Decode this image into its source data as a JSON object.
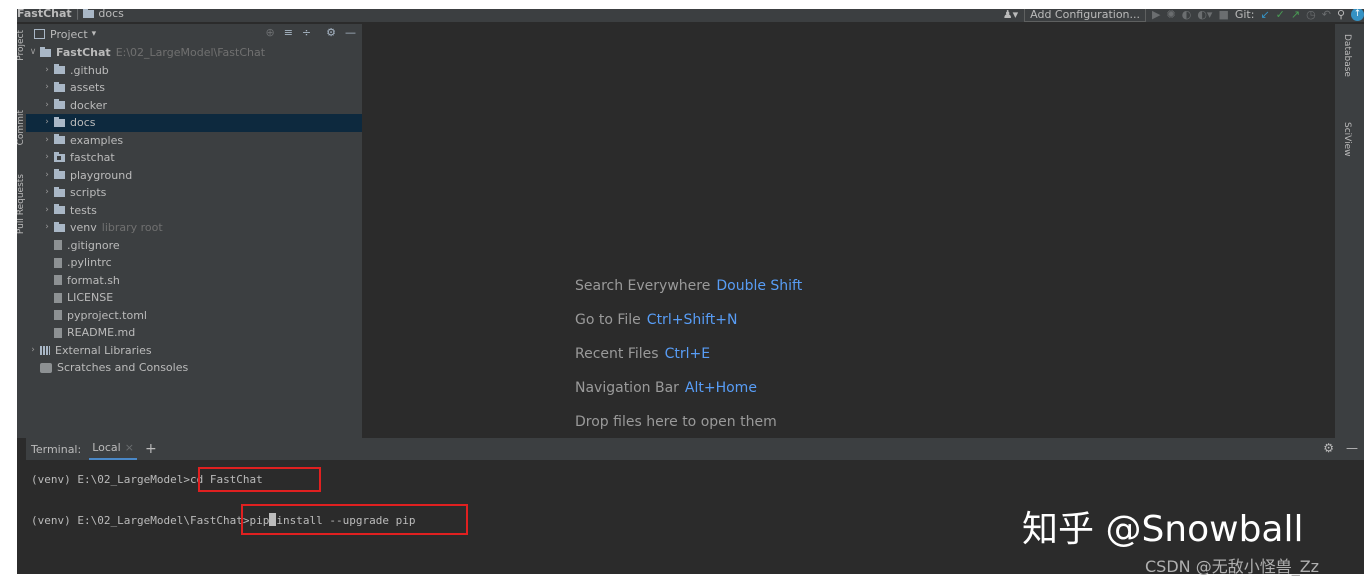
{
  "nav": {
    "project": "FastChat",
    "folder": "docs",
    "add_configuration": "Add Configuration...",
    "git_label": "Git:"
  },
  "left_tabs": {
    "project": "Project",
    "commit": "Commit",
    "pull_requests": "Pull Requests"
  },
  "right_tabs": {
    "database": "Database",
    "sciview": "SciView"
  },
  "project_panel": {
    "title": "Project",
    "root": {
      "name": "FastChat",
      "path": "E:\\02_LargeModel\\FastChat"
    },
    "items": [
      {
        "label": ".github",
        "kind": "folder"
      },
      {
        "label": "assets",
        "kind": "folder"
      },
      {
        "label": "docker",
        "kind": "folder"
      },
      {
        "label": "docs",
        "kind": "folder",
        "selected": true
      },
      {
        "label": "examples",
        "kind": "folder"
      },
      {
        "label": "fastchat",
        "kind": "package"
      },
      {
        "label": "playground",
        "kind": "folder"
      },
      {
        "label": "scripts",
        "kind": "folder"
      },
      {
        "label": "tests",
        "kind": "folder"
      },
      {
        "label": "venv",
        "kind": "folder",
        "suffix": "library root"
      },
      {
        "label": ".gitignore",
        "kind": "file"
      },
      {
        "label": ".pylintrc",
        "kind": "file"
      },
      {
        "label": "format.sh",
        "kind": "file"
      },
      {
        "label": "LICENSE",
        "kind": "file"
      },
      {
        "label": "pyproject.toml",
        "kind": "file"
      },
      {
        "label": "README.md",
        "kind": "file"
      }
    ],
    "external_libraries": "External Libraries",
    "scratches": "Scratches and Consoles"
  },
  "editor_hints": [
    {
      "text": "Search Everywhere",
      "key": "Double Shift"
    },
    {
      "text": "Go to File",
      "key": "Ctrl+Shift+N"
    },
    {
      "text": "Recent Files",
      "key": "Ctrl+E"
    },
    {
      "text": "Navigation Bar",
      "key": "Alt+Home"
    },
    {
      "text": "Drop files here to open them",
      "key": ""
    }
  ],
  "terminal": {
    "label": "Terminal:",
    "tab": "Local",
    "line1_prompt": "(venv) E:\\02_LargeModel",
    "line1_cmd": ">cd FastChat",
    "line2_prompt": "(venv) E:\\02_LargeModel\\FastChat",
    "line2_cmd_a": ">pip",
    "line2_cmd_b": "install --upgrade pip"
  },
  "watermarks": {
    "zhihu": "知乎 @Snowball",
    "csdn": "CSDN @无敌小怪兽_Zz"
  },
  "colors": {
    "background": "#2b2b2b",
    "panel": "#3c3f41",
    "selection": "#0d293e",
    "accent": "#589df6",
    "highlight_box": "#e02020"
  }
}
